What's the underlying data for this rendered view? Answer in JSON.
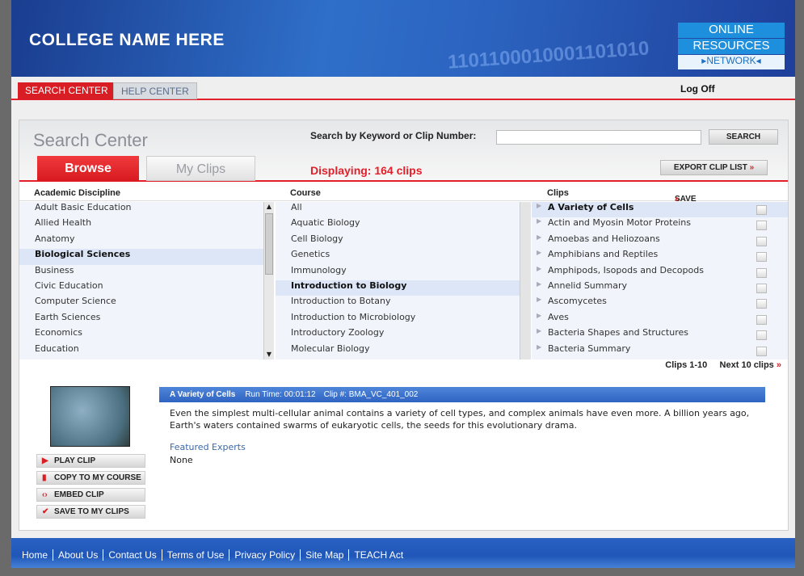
{
  "header": {
    "college_name": "COLLEGE NAME HERE",
    "binary_text": "1101100010001101010",
    "logo": {
      "line1": "ONLINE",
      "line2": "RESOURCES",
      "line3": "▸NETWORK◂"
    }
  },
  "nav": {
    "tabs": [
      {
        "label": "SEARCH CENTER",
        "active": true
      },
      {
        "label": "HELP CENTER",
        "active": false
      }
    ],
    "logoff": "Log Off"
  },
  "search": {
    "title": "Search Center",
    "label": "Search by Keyword or Clip Number:",
    "value": "",
    "button": "SEARCH"
  },
  "browse_tabs": [
    {
      "label": "Browse",
      "active": true
    },
    {
      "label": "My Clips",
      "active": false
    }
  ],
  "displaying": "Displaying: 164 clips",
  "export_label": "EXPORT CLIP LIST",
  "columns": {
    "discipline": "Academic Discipline",
    "course": "Course",
    "clips": "Clips",
    "save_to_my_clips": "SAVE TO MY CLIPS"
  },
  "disciplines": [
    "Adult Basic Education",
    "Allied Health",
    "Anatomy",
    "Biological Sciences",
    "Business",
    "Civic Education",
    "Computer Science",
    "Earth Sciences",
    "Economics",
    "Education"
  ],
  "selected_discipline": "Biological Sciences",
  "courses": [
    "All",
    "Aquatic Biology",
    "Cell Biology",
    "Genetics",
    "Immunology",
    "Introduction to Biology",
    "Introduction to Botany",
    "Introduction to Microbiology",
    "Introductory Zoology",
    "Molecular Biology"
  ],
  "selected_course": "Introduction to Biology",
  "clips": [
    "A Variety of Cells",
    "Actin and Myosin Motor Proteins",
    "Amoebas and Heliozoans",
    "Amphibians and Reptiles",
    "Amphipods, Isopods and Decopods",
    "Annelid Summary",
    "Ascomycetes",
    "Aves",
    "Bacteria Shapes and Structures",
    "Bacteria Summary"
  ],
  "selected_clip": "A Variety of Cells",
  "pager": {
    "range": "Clips 1-10",
    "next": "Next 10 clips"
  },
  "detail": {
    "title": "A Variety of Cells",
    "runtime": "Run Time: 00:01:12",
    "clip_no": "Clip #: BMA_VC_401_002",
    "description": "Even the simplest multi-cellular animal contains a variety of cell types, and complex animals have even more. A billion years ago, Earth's waters contained swarms of eukaryotic cells, the seeds for this evolutionary drama.",
    "featured_label": "Featured Experts",
    "featured_value": "None"
  },
  "actions": [
    {
      "label": "PLAY CLIP",
      "icon": "play-icon"
    },
    {
      "label": "COPY TO MY COURSE",
      "icon": "copy-icon"
    },
    {
      "label": "EMBED CLIP",
      "icon": "embed-icon"
    },
    {
      "label": "SAVE TO MY CLIPS",
      "icon": "checkmark-icon"
    }
  ],
  "footer": [
    "Home",
    "About Us",
    "Contact Us",
    "Terms of Use",
    "Privacy Policy",
    "Site Map",
    "TEACH Act"
  ],
  "colors": {
    "accent_red": "#e3202a",
    "header_blue": "#2b64c0",
    "footer_blue": "#1f56b8"
  }
}
